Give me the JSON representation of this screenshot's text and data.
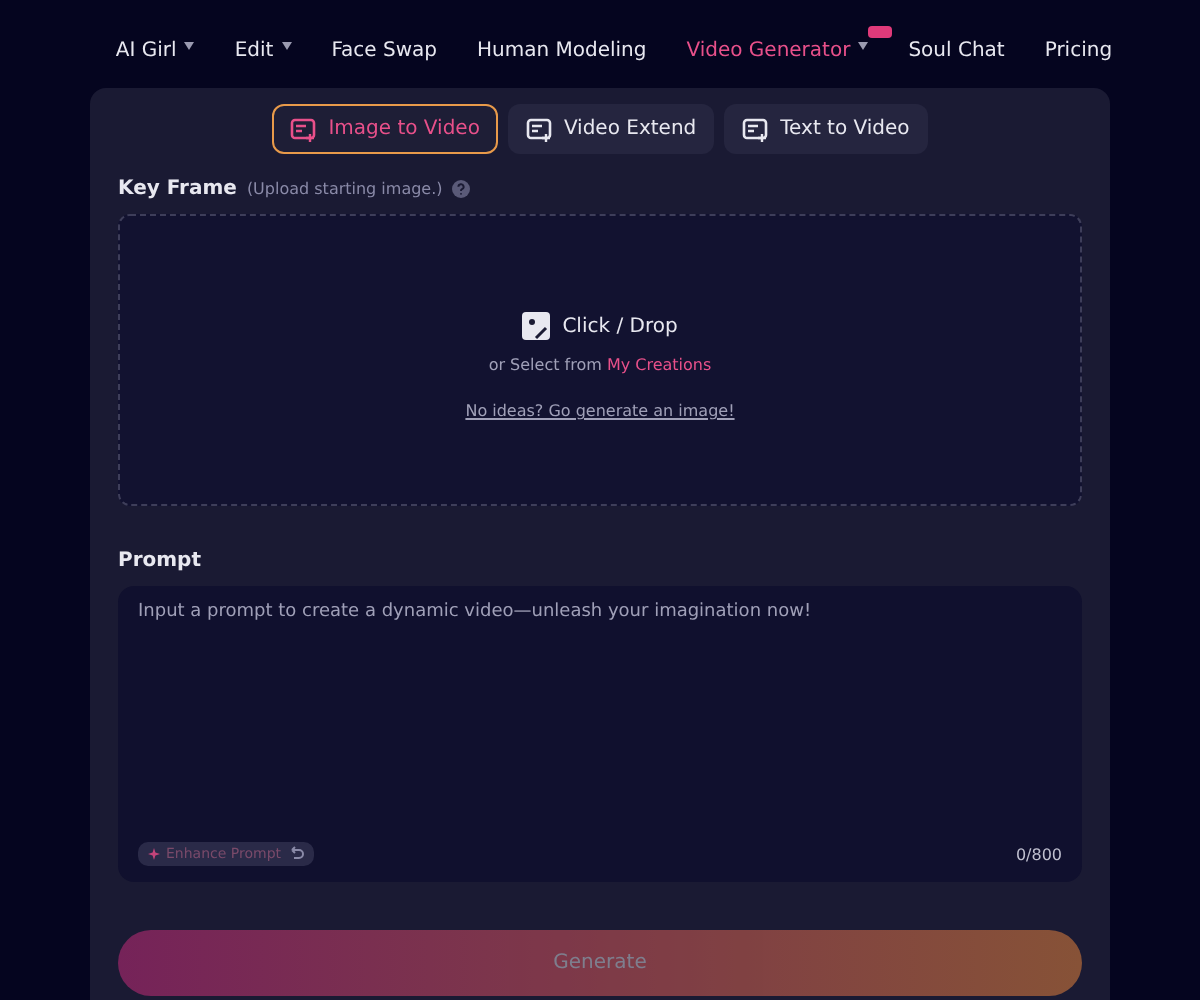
{
  "nav": [
    {
      "label": "AI Girl",
      "dropdown": true,
      "selected": false,
      "badge": false
    },
    {
      "label": "Edit",
      "dropdown": true,
      "selected": false,
      "badge": false
    },
    {
      "label": "Face Swap",
      "dropdown": false,
      "selected": false,
      "badge": false
    },
    {
      "label": "Human Modeling",
      "dropdown": false,
      "selected": false,
      "badge": false
    },
    {
      "label": "Video Generator",
      "dropdown": true,
      "selected": true,
      "badge": true
    },
    {
      "label": "Soul Chat",
      "dropdown": false,
      "selected": false,
      "badge": false
    },
    {
      "label": "Pricing",
      "dropdown": false,
      "selected": false,
      "badge": false
    }
  ],
  "tabs": [
    {
      "label": "Image to Video",
      "selected": true
    },
    {
      "label": "Video Extend",
      "selected": false
    },
    {
      "label": "Text to Video",
      "selected": false
    }
  ],
  "key_frame": {
    "label": "Key Frame",
    "hint": "(Upload starting image.)",
    "drop_label": "Click / Drop",
    "select_text": "or Select from",
    "select_link": "My Creations",
    "generate_link": "No ideas? Go generate an image!"
  },
  "prompt": {
    "label": "Prompt",
    "placeholder": "Input a prompt to create a dynamic video—unleash your imagination now!",
    "enhance": "Enhance Prompt",
    "count": "0/800"
  },
  "generate": {
    "label": "Generate",
    "disabled": true
  }
}
